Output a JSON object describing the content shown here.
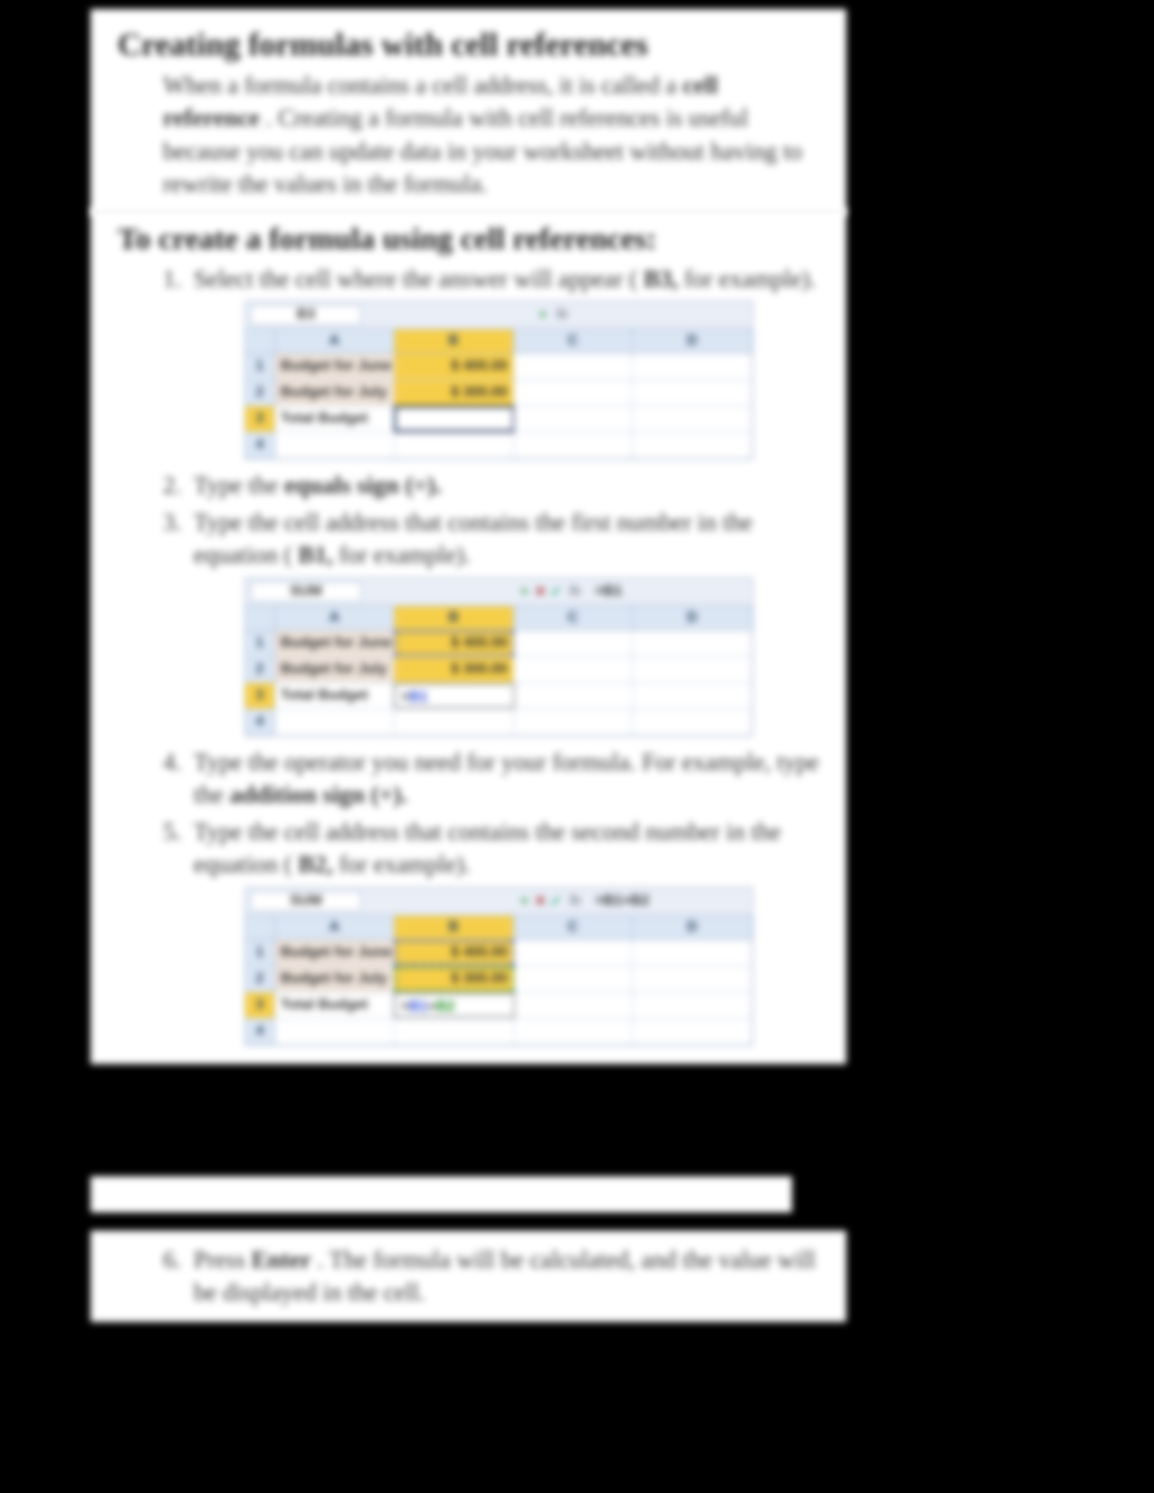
{
  "doc": {
    "h1": "Creating formulas with cell references",
    "intro_parts": {
      "p1a": "When a formula contains a cell address, it is called a ",
      "p1b": "cell reference",
      "p1c": ". Creating a formula with cell references is useful because you can update data in your worksheet without having to rewrite the values in the formula."
    },
    "h2": "To create a formula using cell references:",
    "steps": {
      "s1": {
        "num": "1.",
        "a": "Select the cell where the answer will appear (",
        "b": "B3,",
        "c": " for example)."
      },
      "s2": {
        "num": "2.",
        "a": "Type the ",
        "b": "equals sign (=).",
        "c": ""
      },
      "s3": {
        "num": "3.",
        "a": "Type the cell address that contains the first number in the equation (",
        "b": "B1,",
        "c": " for example)."
      },
      "s4": {
        "num": "4.",
        "a": "Type the operator you need for your formula. For example, type the ",
        "b": "addition sign (+).",
        "c": ""
      },
      "s5": {
        "num": "5.",
        "a": "Type the cell address that contains the second number in the equation (",
        "b": "B2,",
        "c": "for example)."
      },
      "s6": {
        "num": "6.",
        "a": "Press ",
        "b": "Enter",
        "c": ". The formula will be calculated, and the value will be displayed in the cell."
      }
    }
  },
  "shot_common": {
    "cols": {
      "A": "A",
      "B": "B",
      "C": "C",
      "D": "D"
    },
    "rows": {
      "r1": "1",
      "r2": "2",
      "r3": "3",
      "r4": "4"
    },
    "labels": {
      "june": "Budget for June",
      "july": "Budget for July",
      "total": "Total Budget"
    },
    "values": {
      "june": "$ 400.00",
      "july": "$ 300.00"
    },
    "fx": "fx",
    "x": "✕",
    "check": "✓",
    "dd": "▾"
  },
  "shot1": {
    "namebox": "B3",
    "formula": "",
    "b3": ""
  },
  "shot2": {
    "namebox": "SUM",
    "formula": "=B1",
    "b3_prefix": "=",
    "b3_blue": "B1"
  },
  "shot3": {
    "namebox": "SUM",
    "formula": "=B1+B2",
    "b3_prefix": "=",
    "b3_blue": "B1",
    "b3_plus": "+",
    "b3_green": "B2"
  }
}
